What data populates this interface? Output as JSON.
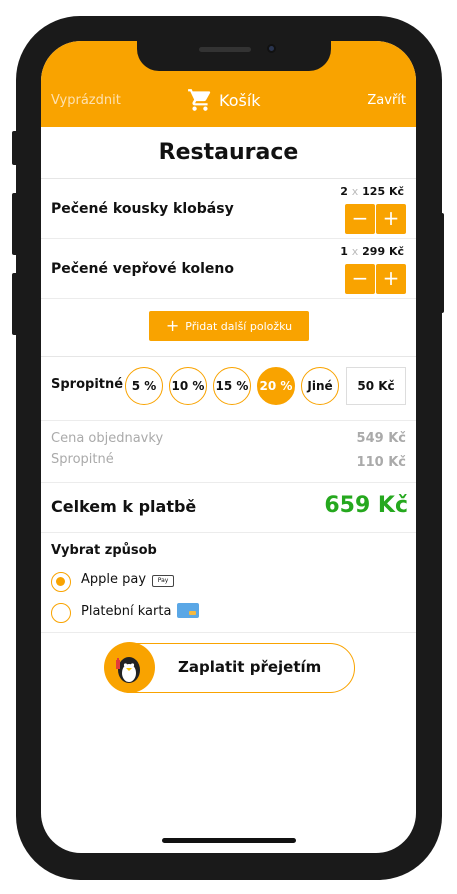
{
  "header": {
    "left": "Vyprázdnit",
    "title": "Košík",
    "right": "Zavřít"
  },
  "restaurant": {
    "name": "Restaurace"
  },
  "items": [
    {
      "name": "Pečené kousky klobásy",
      "qty": "2",
      "x": "x",
      "price": "125 Kč",
      "minus": "−",
      "plus": "+"
    },
    {
      "name": "Pečené vepřové koleno",
      "qty": "1",
      "x": "x",
      "price": "299 Kč",
      "minus": "−",
      "plus": "+"
    }
  ],
  "add_more": {
    "icon": "+",
    "label": "Přidat další položku"
  },
  "tip": {
    "label": "Spropitné",
    "options": [
      "5 %",
      "10 %",
      "15 %",
      "20 %",
      "Jiné"
    ],
    "selected": "20 %",
    "custom": "50 Kč"
  },
  "summary": {
    "order_label": "Cena objednavky",
    "order_value": "549 Kč",
    "tip_label": "Spropitné",
    "tip_value": "110 Kč"
  },
  "total": {
    "label": "Celkem k platbě",
    "value": "659 Kč"
  },
  "payment": {
    "title": "Vybrat způsob",
    "methods": [
      {
        "label": "Apple pay",
        "badge": "Pay",
        "selected": true
      },
      {
        "label": "Platební karta",
        "selected": false
      }
    ]
  },
  "pay_button": {
    "label": "Zaplatit přejetím"
  },
  "colors": {
    "accent": "#f9a300",
    "total": "#25a81e"
  }
}
